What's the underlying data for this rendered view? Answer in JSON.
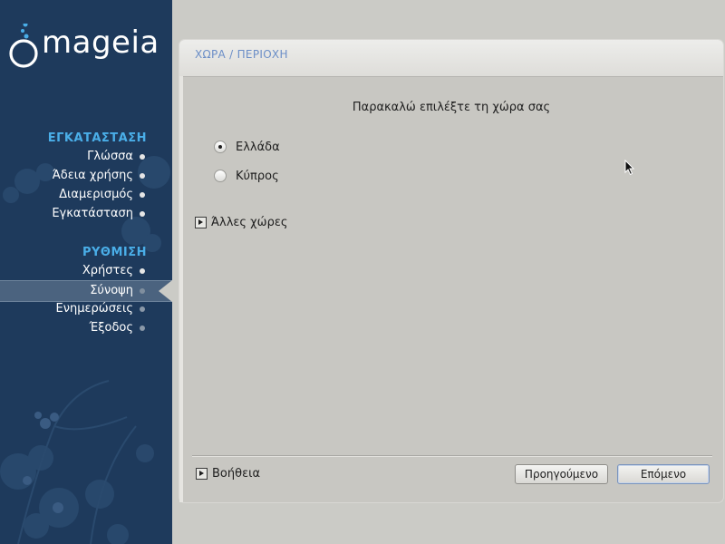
{
  "sidebar": {
    "logo_text": "mageia",
    "sections": [
      {
        "title": "ΕΓΚΑΤΑΣΤΑΣΗ"
      },
      {
        "title": "ΡΥΘΜΙΣΗ"
      }
    ],
    "install_items": [
      {
        "label": "Γλώσσα",
        "state": "done"
      },
      {
        "label": "Άδεια χρήσης",
        "state": "done"
      },
      {
        "label": "Διαμερισμός",
        "state": "done"
      },
      {
        "label": "Εγκατάσταση",
        "state": "done"
      }
    ],
    "config_items": [
      {
        "label": "Χρήστες",
        "state": "done"
      },
      {
        "label": "Σύνοψη",
        "state": "current"
      },
      {
        "label": "Ενημερώσεις",
        "state": "pending"
      },
      {
        "label": "Έξοδος",
        "state": "pending"
      }
    ]
  },
  "panel": {
    "title": "ΧΩΡΑ / ΠΕΡΙΟΧΗ",
    "prompt": "Παρακαλώ επιλέξτε τη χώρα σας",
    "options": [
      {
        "label": "Ελλάδα",
        "checked": true
      },
      {
        "label": "Κύπρος",
        "checked": false
      }
    ],
    "other_countries_label": "Άλλες χώρες",
    "help_label": "Βοήθεια",
    "previous_label": "Προηγούμενο",
    "next_label": "Επόμενο"
  },
  "colors": {
    "sidebar_bg": "#1e3a5c",
    "section_title": "#4aaee8",
    "panel_title": "#6b8ec7",
    "panel_bg": "#c8c7c2"
  }
}
